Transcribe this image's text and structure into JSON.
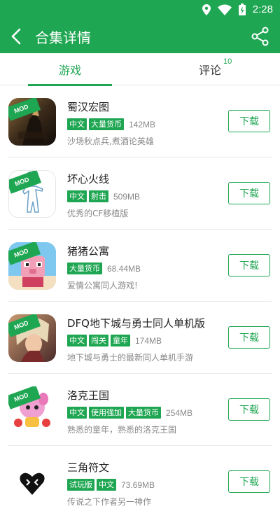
{
  "status": {
    "time": "2:28"
  },
  "header": {
    "title": "合集详情"
  },
  "tabs": [
    {
      "label": "游戏"
    },
    {
      "label": "评论",
      "badge": "10"
    }
  ],
  "download_label": "下载",
  "mod_label": "MOD",
  "items": [
    {
      "name": "蜀汉宏图",
      "tags": [
        "中文",
        "大量货币"
      ],
      "size": "142MB",
      "desc": "沙场秋点兵,煮酒论英雄"
    },
    {
      "name": "坏心火线",
      "tags": [
        "中文",
        "射击"
      ],
      "size": "509MB",
      "desc": "优秀的CF移植版"
    },
    {
      "name": "猪猪公寓",
      "tags": [
        "大量货币"
      ],
      "size": "68.44MB",
      "desc": "爱情公寓同人游戏!"
    },
    {
      "name": "DFQ地下城与勇士同人单机版",
      "tags": [
        "中文",
        "闯关",
        "童年"
      ],
      "size": "174MB",
      "desc": "地下城与勇士的最新同人单机手游"
    },
    {
      "name": "洛克王国",
      "tags": [
        "中文",
        "使用强加",
        "大量货币"
      ],
      "size": "254MB",
      "desc": "熟悉的童年，熟悉的洛克王国"
    },
    {
      "name": "三角符文",
      "tags": [
        "试玩版",
        "中文"
      ],
      "size": "73.69MB",
      "desc": "传说之下作者另一神作"
    }
  ],
  "colors": {
    "brand": "#1fa652"
  }
}
